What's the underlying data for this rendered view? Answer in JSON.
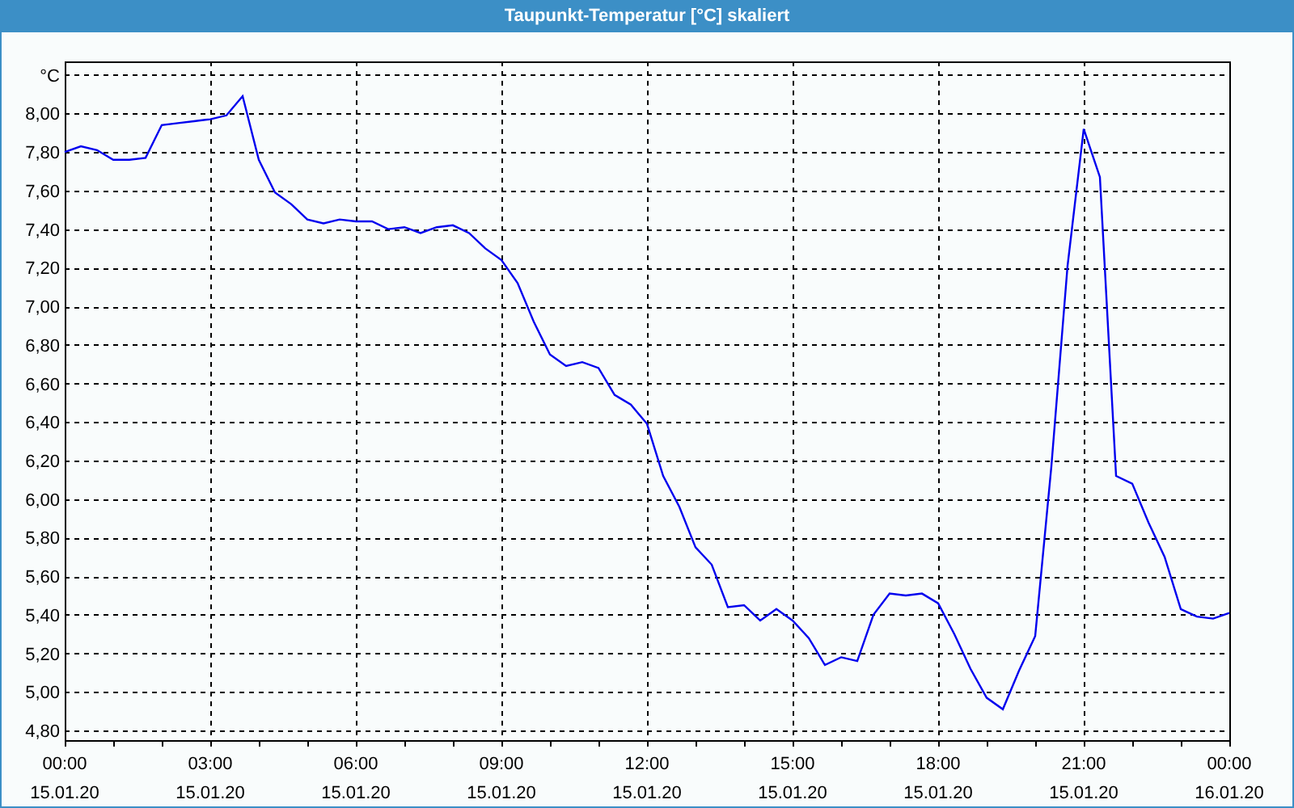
{
  "window": {
    "title": "Taupunkt-Temperatur [°C] skaliert"
  },
  "chart": {
    "chart_data": {
      "type": "line",
      "grid": true,
      "ylim": [
        4.75,
        8.27
      ],
      "yticks": [
        {
          "value": 4.8,
          "label": "4,80"
        },
        {
          "value": 5.0,
          "label": "5,00"
        },
        {
          "value": 5.2,
          "label": "5,20"
        },
        {
          "value": 5.4,
          "label": "5,40"
        },
        {
          "value": 5.6,
          "label": "5,60"
        },
        {
          "value": 5.8,
          "label": "5,80"
        },
        {
          "value": 6.0,
          "label": "6,00"
        },
        {
          "value": 6.2,
          "label": "6,20"
        },
        {
          "value": 6.4,
          "label": "6,40"
        },
        {
          "value": 6.6,
          "label": "6,60"
        },
        {
          "value": 6.8,
          "label": "6,80"
        },
        {
          "value": 7.0,
          "label": "7,00"
        },
        {
          "value": 7.2,
          "label": "7,20"
        },
        {
          "value": 7.4,
          "label": "7,40"
        },
        {
          "value": 7.6,
          "label": "7,60"
        },
        {
          "value": 7.8,
          "label": "7,80"
        },
        {
          "value": 8.0,
          "label": "8,00"
        },
        {
          "value": 8.2,
          "label": "°C"
        }
      ],
      "categories": [
        "00:00\n15.01.20",
        null,
        null,
        null,
        null,
        null,
        null,
        null,
        null,
        "03:00\n15.01.20",
        null,
        null,
        null,
        null,
        null,
        null,
        null,
        null,
        "06:00\n15.01.20",
        null,
        null,
        null,
        null,
        null,
        null,
        null,
        null,
        "09:00\n15.01.20",
        null,
        null,
        null,
        null,
        null,
        null,
        null,
        null,
        "12:00\n15.01.20",
        null,
        null,
        null,
        null,
        null,
        null,
        null,
        null,
        "15:00\n15.01.20",
        null,
        null,
        null,
        null,
        null,
        null,
        null,
        null,
        "18:00\n15.01.20",
        null,
        null,
        null,
        null,
        null,
        null,
        null,
        null,
        "21:00\n15.01.20",
        null,
        null,
        null,
        null,
        null,
        null,
        null,
        null,
        "00:00\n16.01.20"
      ],
      "series": [
        {
          "color": "#0000ee",
          "values": [
            7.8,
            7.83,
            7.81,
            7.76,
            7.76,
            7.77,
            7.94,
            7.95,
            7.96,
            7.97,
            7.99,
            8.09,
            7.76,
            7.59,
            7.53,
            7.45,
            7.43,
            7.45,
            7.44,
            7.44,
            7.4,
            7.41,
            7.38,
            7.41,
            7.42,
            7.38,
            7.3,
            7.24,
            7.12,
            6.92,
            6.75,
            6.69,
            6.71,
            6.68,
            6.54,
            6.49,
            6.39,
            6.12,
            5.96,
            5.75,
            5.66,
            5.44,
            5.45,
            5.37,
            5.43,
            5.37,
            5.28,
            5.14,
            5.18,
            5.16,
            5.4,
            5.51,
            5.5,
            5.51,
            5.46,
            5.3,
            5.12,
            4.97,
            4.91,
            5.11,
            5.29,
            6.17,
            7.21,
            7.92,
            7.67,
            6.12,
            6.08,
            5.88,
            5.7,
            5.43,
            5.39,
            5.38,
            5.41
          ]
        }
      ]
    }
  }
}
